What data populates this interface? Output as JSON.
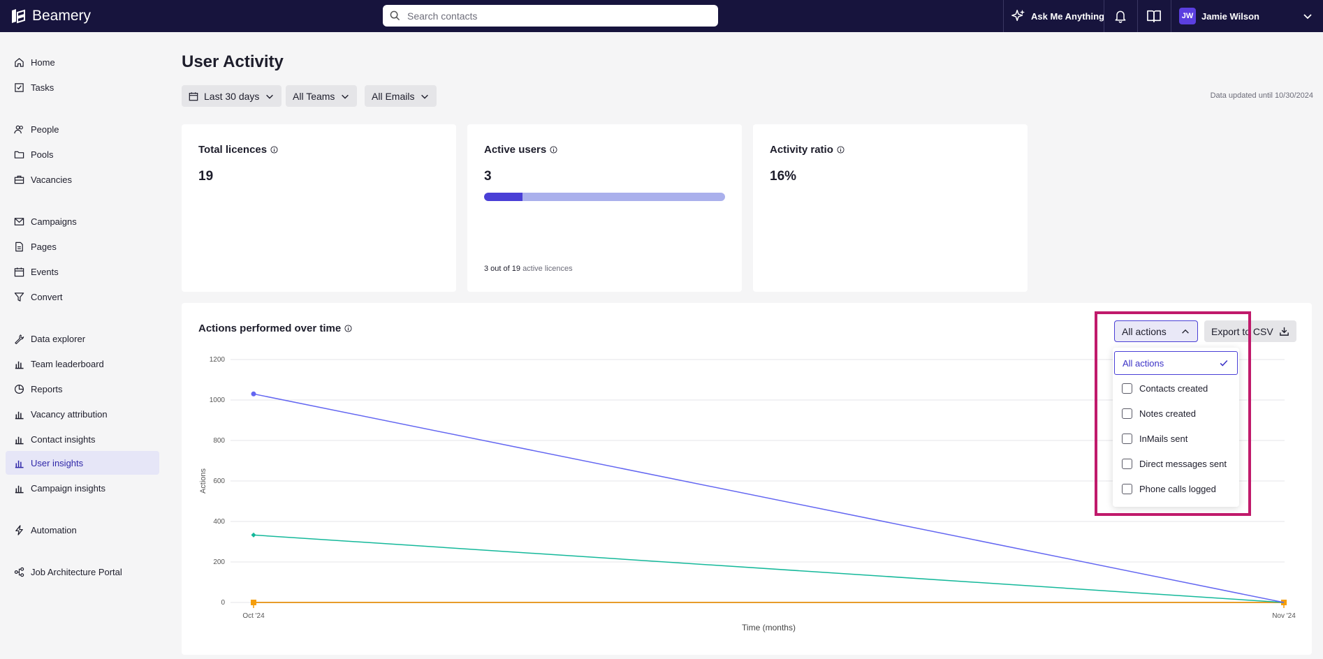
{
  "app": {
    "name": "Beamery"
  },
  "search": {
    "placeholder": "Search contacts"
  },
  "topbar": {
    "ask_label": "Ask Me Anything",
    "user_initials": "JW",
    "user_name": "Jamie Wilson"
  },
  "sidebar": {
    "items": [
      {
        "label": "Home",
        "icon": "home-icon"
      },
      {
        "label": "Tasks",
        "icon": "tasks-icon"
      },
      {
        "label": "People",
        "icon": "people-icon"
      },
      {
        "label": "Pools",
        "icon": "folder-icon"
      },
      {
        "label": "Vacancies",
        "icon": "briefcase-icon"
      },
      {
        "label": "Campaigns",
        "icon": "mail-icon"
      },
      {
        "label": "Pages",
        "icon": "page-icon"
      },
      {
        "label": "Events",
        "icon": "calendar-icon"
      },
      {
        "label": "Convert",
        "icon": "filter-icon"
      },
      {
        "label": "Data explorer",
        "icon": "wrench-icon"
      },
      {
        "label": "Team leaderboard",
        "icon": "bar-chart-icon"
      },
      {
        "label": "Reports",
        "icon": "pie-chart-icon"
      },
      {
        "label": "Vacancy attribution",
        "icon": "bar-chart-icon"
      },
      {
        "label": "Contact insights",
        "icon": "bar-chart-icon"
      },
      {
        "label": "User insights",
        "icon": "bar-chart-icon",
        "active": true
      },
      {
        "label": "Campaign insights",
        "icon": "bar-chart-icon"
      },
      {
        "label": "Automation",
        "icon": "lightning-icon"
      },
      {
        "label": "Job Architecture Portal",
        "icon": "hierarchy-icon"
      }
    ]
  },
  "page": {
    "title": "User Activity",
    "filters": {
      "date": "Last 30 days",
      "teams": "All Teams",
      "emails": "All Emails"
    },
    "updated": "Data updated until 10/30/2024"
  },
  "cards": {
    "licences": {
      "title": "Total licences",
      "value": "19"
    },
    "active": {
      "title": "Active users",
      "value": "3",
      "progress_fraction": 0.158,
      "foot_a": "3 out of 19",
      "foot_b": "active licences"
    },
    "ratio": {
      "title": "Activity ratio",
      "value": "16%"
    }
  },
  "actions_panel": {
    "title": "Actions performed over time",
    "select_label": "All actions",
    "export_label": "Export to CSV",
    "options": [
      "All actions",
      "Contacts created",
      "Notes created",
      "InMails sent",
      "Direct messages sent",
      "Phone calls logged"
    ]
  },
  "chart_data": {
    "type": "line",
    "title": "Actions performed over time",
    "xlabel": "Time (months)",
    "ylabel": "Actions",
    "categories": [
      "Oct '24",
      "Nov '24"
    ],
    "ylim": [
      0,
      1200
    ],
    "yticks": [
      0,
      200,
      400,
      600,
      800,
      1000,
      1200
    ],
    "grid": true,
    "series": [
      {
        "values": [
          1030,
          0
        ],
        "color": "#6366f1",
        "marker": "circle"
      },
      {
        "values": [
          333,
          0
        ],
        "color": "#14b89a",
        "marker": "diamond"
      },
      {
        "values": [
          0,
          0
        ],
        "color": "#f59e0b",
        "marker": "square"
      },
      {
        "values": [
          0,
          0
        ],
        "color": "#7a2e0e",
        "marker": "none"
      }
    ]
  },
  "colors": {
    "accent": "#4a3fd6",
    "topbar": "#17143d",
    "highlight": "#c01a6b"
  }
}
